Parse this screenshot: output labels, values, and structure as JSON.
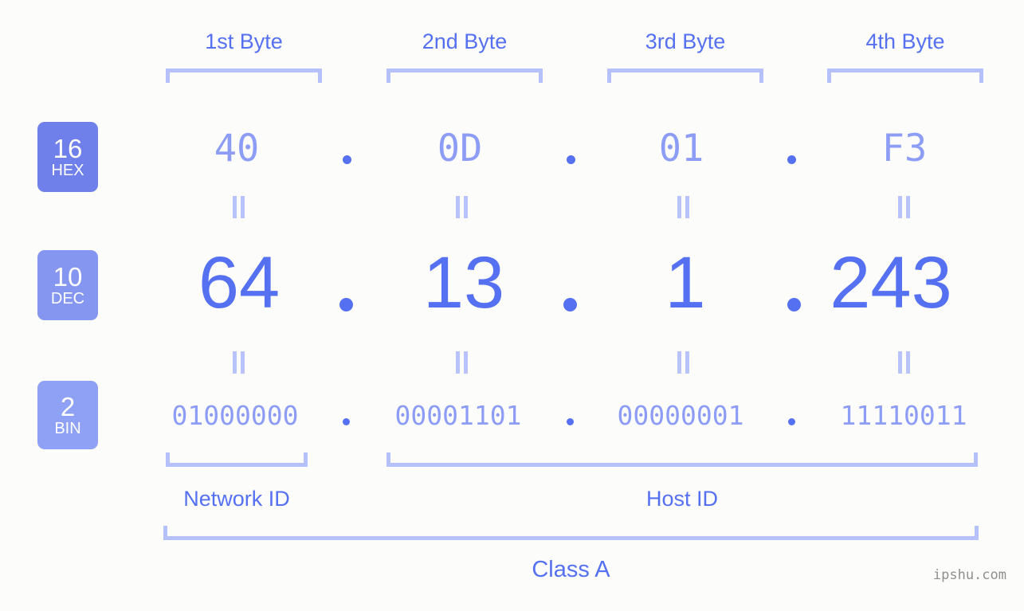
{
  "background_color": "#fcfdfa",
  "accent_color": "#5570f1",
  "muted_color": "#8d9df5",
  "bracket_color": "#b6c0fb",
  "byte_headers": [
    {
      "label": "1st Byte"
    },
    {
      "label": "2nd Byte"
    },
    {
      "label": "3rd Byte"
    },
    {
      "label": "4th Byte"
    }
  ],
  "rows": {
    "hex": {
      "badge_number": "16",
      "badge_abbr": "HEX",
      "badge_color": "#6f80ea",
      "values": [
        "40",
        "0D",
        "01",
        "F3"
      ],
      "separator": "."
    },
    "dec": {
      "badge_number": "10",
      "badge_abbr": "DEC",
      "badge_color": "#8596f0",
      "values": [
        "64",
        "13",
        "1",
        "243"
      ],
      "separator": "."
    },
    "bin": {
      "badge_number": "2",
      "badge_abbr": "BIN",
      "badge_color": "#8fa1f4",
      "values": [
        "01000000",
        "00001101",
        "00000001",
        "11110011"
      ],
      "separator": "."
    }
  },
  "equality_marker": "||",
  "sections": [
    {
      "label": "Network ID"
    },
    {
      "label": "Host ID"
    }
  ],
  "class": {
    "label": "Class A"
  },
  "watermark": {
    "text": "ipshu.com"
  }
}
